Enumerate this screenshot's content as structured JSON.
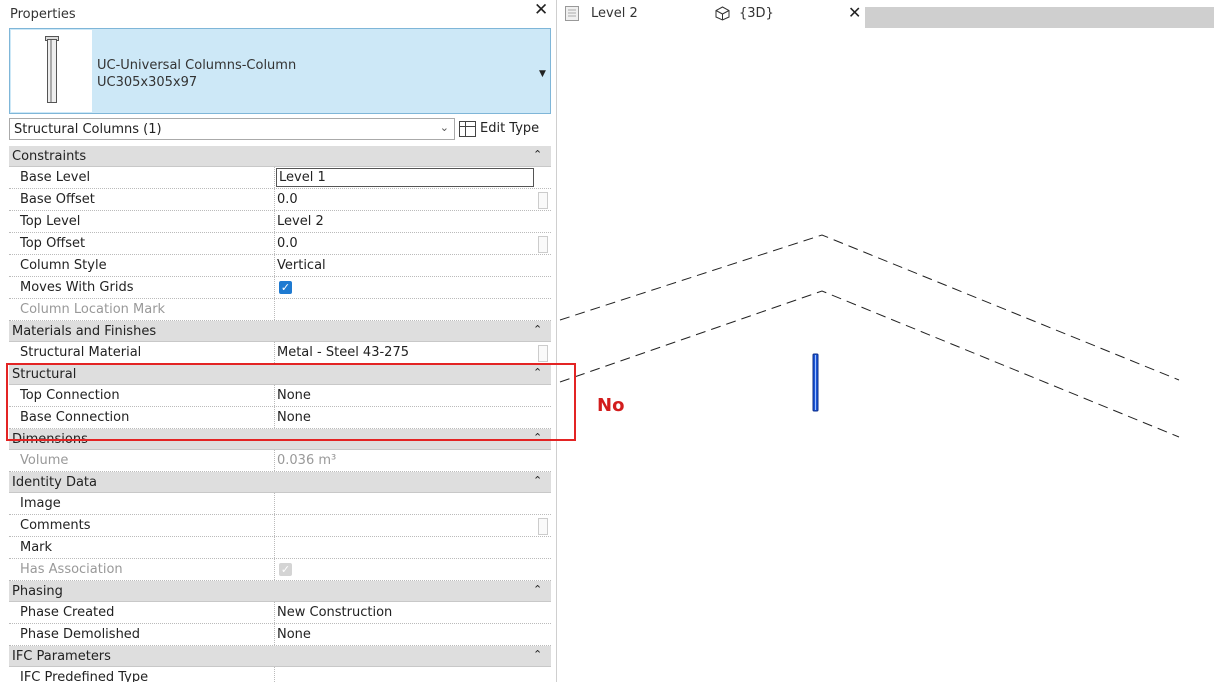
{
  "properties_panel": {
    "title": "Properties",
    "close_glyph": "✕",
    "type_selector": {
      "family": "UC-Universal Columns-Column",
      "type": "UC305x305x97",
      "dropdown_glyph": "▼"
    },
    "instance_filter": {
      "value": "Structural Columns (1)",
      "dropdown_glyph": "⌄"
    },
    "edit_type_label": "Edit Type",
    "groups": [
      {
        "name": "Constraints",
        "collapse_glyph": "⌃",
        "rows": [
          {
            "name": "Base Level",
            "value": "Level 1"
          },
          {
            "name": "Base Offset",
            "value": "0.0"
          },
          {
            "name": "Top Level",
            "value": "Level 2"
          },
          {
            "name": "Top Offset",
            "value": "0.0"
          },
          {
            "name": "Column Style",
            "value": "Vertical"
          },
          {
            "name": "Moves With Grids",
            "value": "✓"
          },
          {
            "name": "Column Location Mark",
            "value": ""
          }
        ]
      },
      {
        "name": "Materials and Finishes",
        "collapse_glyph": "⌃",
        "rows": [
          {
            "name": "Structural Material",
            "value": "Metal - Steel 43-275"
          }
        ]
      },
      {
        "name": "Structural",
        "collapse_glyph": "⌃",
        "rows": [
          {
            "name": "Top Connection",
            "value": "None"
          },
          {
            "name": "Base Connection",
            "value": "None"
          }
        ]
      },
      {
        "name": "Dimensions",
        "collapse_glyph": "⌃",
        "rows": [
          {
            "name": "Volume",
            "value": "0.036 m³"
          }
        ]
      },
      {
        "name": "Identity Data",
        "collapse_glyph": "⌃",
        "rows": [
          {
            "name": "Image",
            "value": ""
          },
          {
            "name": "Comments",
            "value": ""
          },
          {
            "name": "Mark",
            "value": ""
          },
          {
            "name": "Has Association",
            "value": "✓"
          }
        ]
      },
      {
        "name": "Phasing",
        "collapse_glyph": "⌃",
        "rows": [
          {
            "name": "Phase Created",
            "value": "New Construction"
          },
          {
            "name": "Phase Demolished",
            "value": "None"
          }
        ]
      },
      {
        "name": "IFC Parameters",
        "collapse_glyph": "⌃",
        "rows": [
          {
            "name": "IFC Predefined Type",
            "value": ""
          }
        ]
      }
    ]
  },
  "view_tabs": [
    {
      "label": "Level 2",
      "icon": "floor-plan-icon"
    },
    {
      "label": "{3D}",
      "icon": "3d-view-icon",
      "close_glyph": "✕"
    }
  ],
  "annotation": {
    "text": "No",
    "color": "#d21d1d",
    "box_color": "#e32424"
  },
  "colors": {
    "type_selector_bg": "#cde8f7",
    "group_bg": "#dedede",
    "checkbox": "#1e7ad1",
    "column_element": "#1b55d6"
  }
}
